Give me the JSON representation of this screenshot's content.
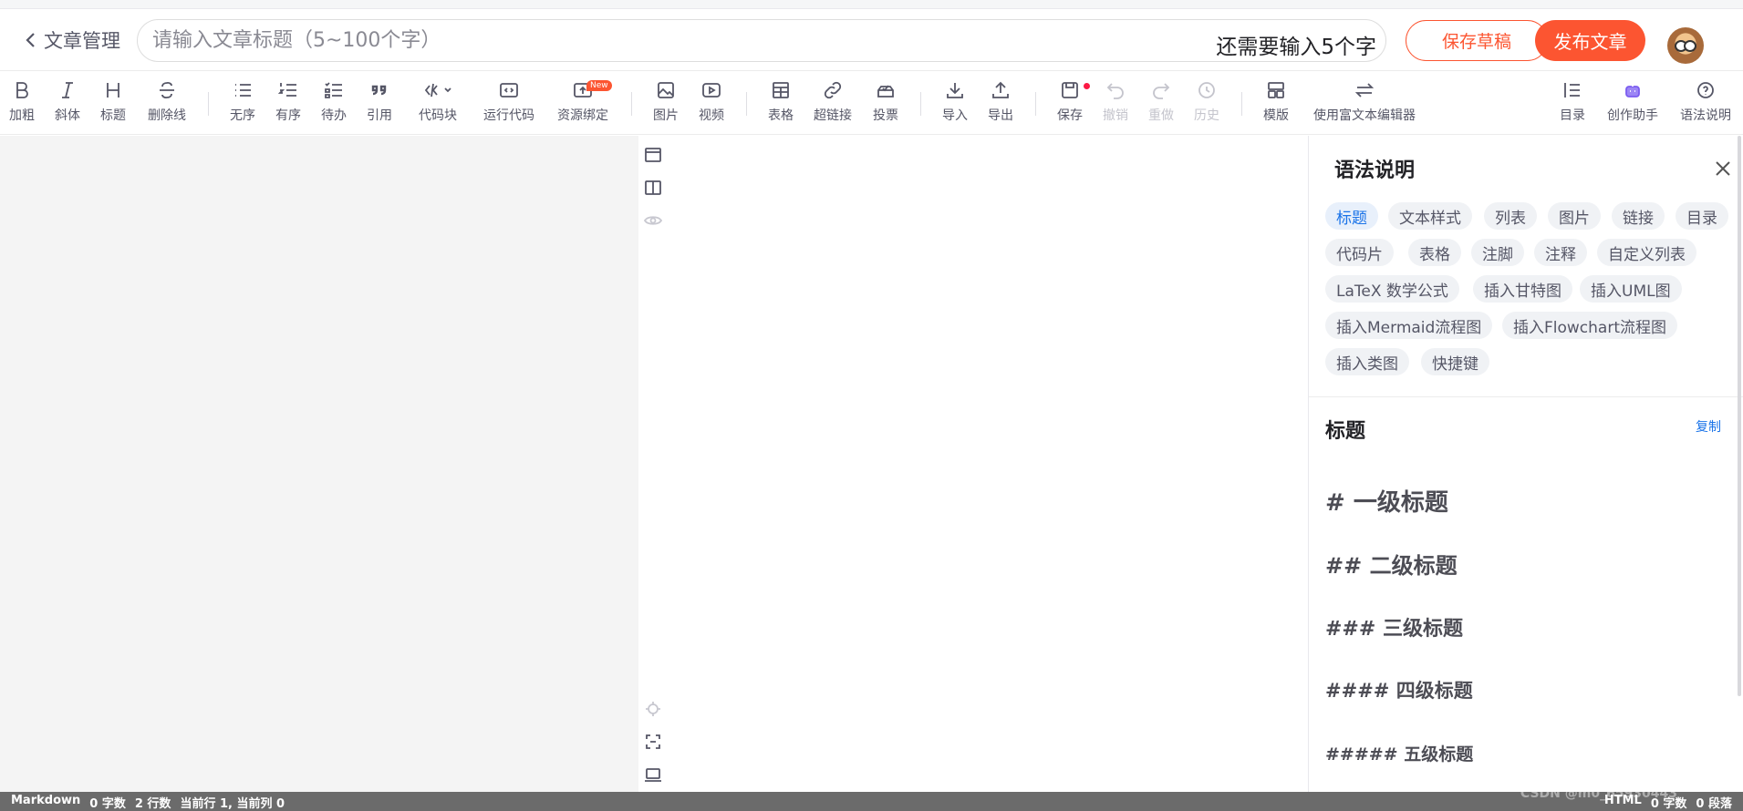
{
  "header": {
    "back_label": "文章管理",
    "title_placeholder": "请输入文章标题（5~100个字）",
    "title_value": "",
    "remaining_hint": "还需要输入5个字",
    "save_draft_label": "保存草稿",
    "publish_label": "发布文章"
  },
  "toolbar": {
    "items": [
      {
        "label": "加粗",
        "icon": "bold-icon"
      },
      {
        "label": "斜体",
        "icon": "italic-icon"
      },
      {
        "label": "标题",
        "icon": "heading-icon"
      },
      {
        "label": "删除线",
        "icon": "strikethrough-icon"
      },
      {
        "label": "无序",
        "icon": "unordered-list-icon"
      },
      {
        "label": "有序",
        "icon": "ordered-list-icon"
      },
      {
        "label": "待办",
        "icon": "todo-list-icon"
      },
      {
        "label": "引用",
        "icon": "quote-icon"
      },
      {
        "label": "代码块",
        "icon": "code-block-icon"
      },
      {
        "label": "运行代码",
        "icon": "run-code-icon"
      },
      {
        "label": "资源绑定",
        "icon": "resource-bind-icon",
        "badge": "New"
      },
      {
        "label": "图片",
        "icon": "image-icon"
      },
      {
        "label": "视频",
        "icon": "video-icon"
      },
      {
        "label": "表格",
        "icon": "table-icon"
      },
      {
        "label": "超链接",
        "icon": "link-icon"
      },
      {
        "label": "投票",
        "icon": "vote-icon"
      },
      {
        "label": "导入",
        "icon": "import-icon"
      },
      {
        "label": "导出",
        "icon": "export-icon"
      },
      {
        "label": "保存",
        "icon": "save-icon"
      },
      {
        "label": "撤销",
        "icon": "undo-icon",
        "disabled": true
      },
      {
        "label": "重做",
        "icon": "redo-icon",
        "disabled": true
      },
      {
        "label": "历史",
        "icon": "history-icon",
        "disabled": true
      },
      {
        "label": "模版",
        "icon": "template-icon"
      },
      {
        "label": "使用富文本编辑器",
        "icon": "switch-editor-icon"
      },
      {
        "label": "目录",
        "icon": "toc-icon"
      },
      {
        "label": "创作助手",
        "icon": "assistant-icon"
      },
      {
        "label": "语法说明",
        "icon": "help-icon"
      }
    ]
  },
  "syntax_panel": {
    "title": "语法说明",
    "tags": [
      "标题",
      "文本样式",
      "列表",
      "图片",
      "链接",
      "目录",
      "代码片",
      "表格",
      "注脚",
      "注释",
      "自定义列表",
      "LaTeX 数学公式",
      "插入甘特图",
      "插入UML图",
      "插入Mermaid流程图",
      "插入Flowchart流程图",
      "插入类图",
      "快捷键"
    ],
    "active_tag": "标题",
    "section_title": "标题",
    "copy_label": "复制",
    "headings": [
      "# 一级标题",
      "## 二级标题",
      "### 三级标题",
      "#### 四级标题",
      "##### 五级标题"
    ]
  },
  "statusbar": {
    "left": [
      "Markdown",
      "0 字数",
      "2 行数",
      "当前行 1, 当前列 0"
    ],
    "right": [
      "HTML",
      "0 字数",
      "0 段落"
    ],
    "watermark": "CSDN @m0_65930443"
  },
  "colors": {
    "accent": "#fc5531",
    "link": "#1a73e8",
    "statusbar": "#6b6b6b"
  }
}
